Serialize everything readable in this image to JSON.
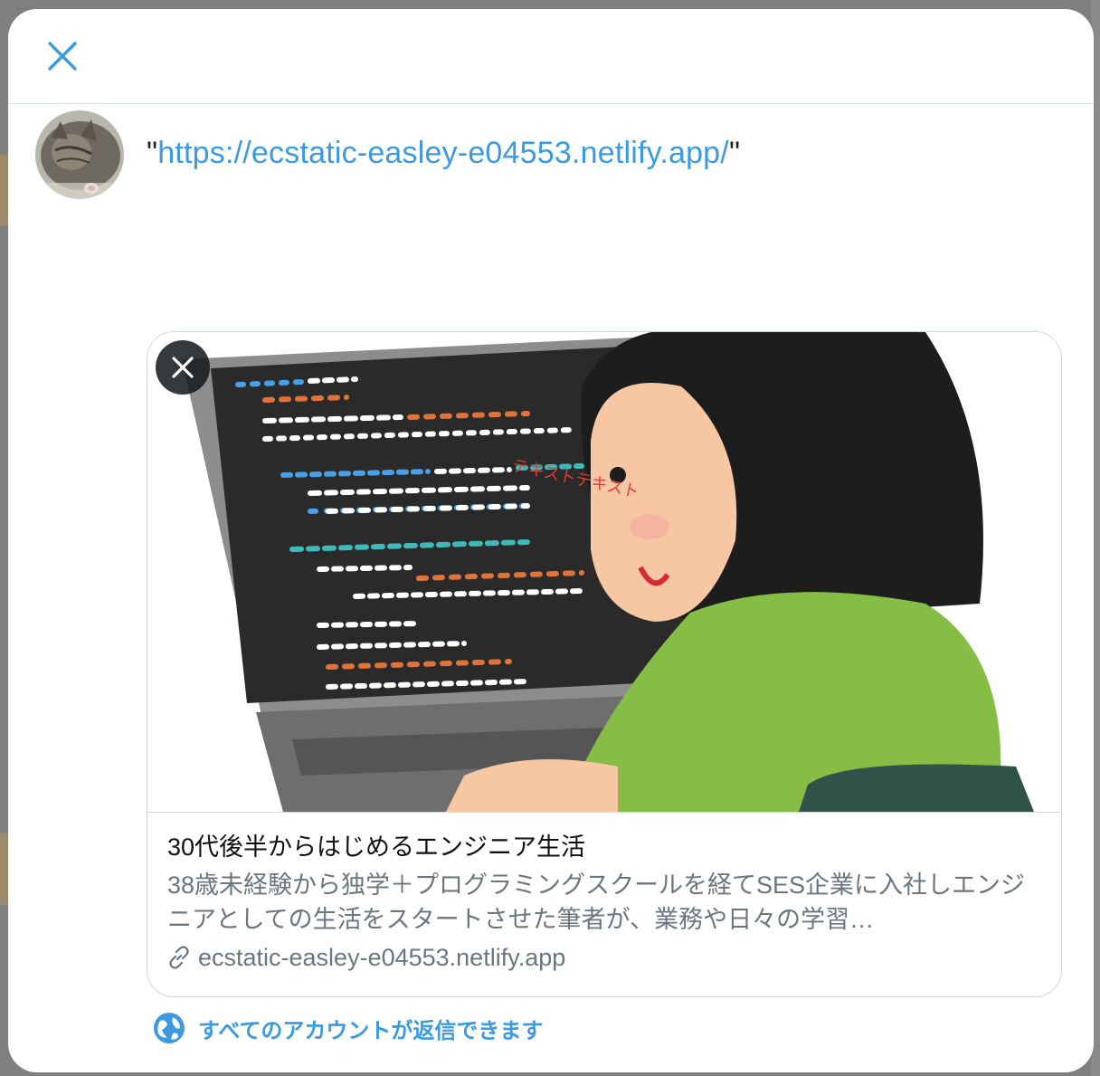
{
  "tweet": {
    "quote_open": "\"",
    "link": "https://ecstatic-easley-e04553.netlify.app/",
    "quote_close": "\""
  },
  "card": {
    "image_overlay_text": "テキストテキスト",
    "title": "30代後半からはじめるエンジニア生活",
    "description": "38歳未経験から独学＋プログラミングスクールを経てSES企業に入社しエンジニアとしての生活をスタートさせた筆者が、業務や日々の学習…",
    "domain": "ecstatic-easley-e04553.netlify.app"
  },
  "reply_setting": {
    "label": "すべてのアカウントが返信できます"
  },
  "colors": {
    "accent": "#3b9ae1",
    "border": "#cfd9de",
    "secondary_text": "#6b7680"
  },
  "icons": {
    "close": "close-icon",
    "card_remove": "close-icon",
    "link": "link-icon",
    "globe": "globe-icon"
  }
}
